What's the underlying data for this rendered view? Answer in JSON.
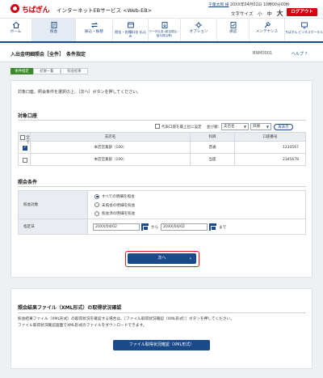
{
  "header": {
    "logo_text": "ちばぎん",
    "service_name": "インターネットEBサービス <Web-EB>",
    "user_name": "千葉太郎 様",
    "last_login": "20XX年04月02日 10時00分00秒",
    "font_size_label": "文字サイズ",
    "font_sizes": [
      "小",
      "中",
      "大"
    ],
    "logout_label": "ログアウト"
  },
  "nav": {
    "items": [
      {
        "label": "ホーム",
        "icon": "home-icon"
      },
      {
        "label": "照会",
        "icon": "inquiry-icon"
      },
      {
        "label": "振込・振替",
        "icon": "transfer-icon"
      },
      {
        "label": "税金・各種料金 払込み",
        "icon": "tax-payment-icon"
      },
      {
        "label": "データ伝送 (総合振込・給与振込等)",
        "icon": "data-transmission-icon"
      },
      {
        "label": "オプション",
        "icon": "option-icon"
      },
      {
        "label": "承認",
        "icon": "approval-icon"
      },
      {
        "label": "メンテナンス",
        "icon": "maintenance-icon"
      },
      {
        "label": "ちばぎん ビジネスポータル",
        "icon": "portal-icon"
      }
    ],
    "active_index": 1
  },
  "page": {
    "title": "入出金明細照会［全件］　条件指定",
    "screen_id": "BNM0001",
    "help_label": "ヘルプ"
  },
  "steps": [
    "条件指定",
    "結果一覧",
    "照会結果"
  ],
  "instruction": "対象口座、照会条件を選択の上、［次へ］ボタンを押してください。",
  "accounts": {
    "section_title": "対象口座",
    "set_representative_label": "代表口座を最上位に設定",
    "sort_label": "並び順：",
    "sort_field": "支店名",
    "sort_order": "昇順",
    "resort_label": "再表示",
    "columns": [
      "全て",
      "支店名",
      "科目",
      "口座番号"
    ],
    "rows": [
      {
        "checked": true,
        "branch": "本店営業部（100）",
        "type": "普通",
        "number": "1234567"
      },
      {
        "checked": false,
        "branch": "本店営業部（100）",
        "type": "当座",
        "number": "2345678"
      }
    ]
  },
  "conditions": {
    "section_title": "照会条件",
    "target_label": "照会対象",
    "options": [
      "すべての明細を照会",
      "未照会の明細を照会",
      "照会済の明細を照会"
    ],
    "selected_option": 0,
    "period_label": "指定日",
    "date_from": "20XX/04/02",
    "date_to": "20XX/04/02",
    "from_word": "から",
    "to_word": "まで"
  },
  "next_label": "次へ",
  "xml": {
    "title": "照会結果ファイル（XML形式）の取得状況確認",
    "text1": "照会結果ファイル（XML形式）の取得状況を確認する場合は、［ファイル取得状況確認（XML形式）］ボタンを押してください。",
    "text2": "ファイル取得状況確認画面でXML形式のファイルをダウンロードできます。",
    "button_label": "ファイル取得状況確認（XML形式）"
  },
  "colors": {
    "brand_red": "#d7000f",
    "navy": "#1a4a8a",
    "step_green": "#3a8a2a"
  }
}
